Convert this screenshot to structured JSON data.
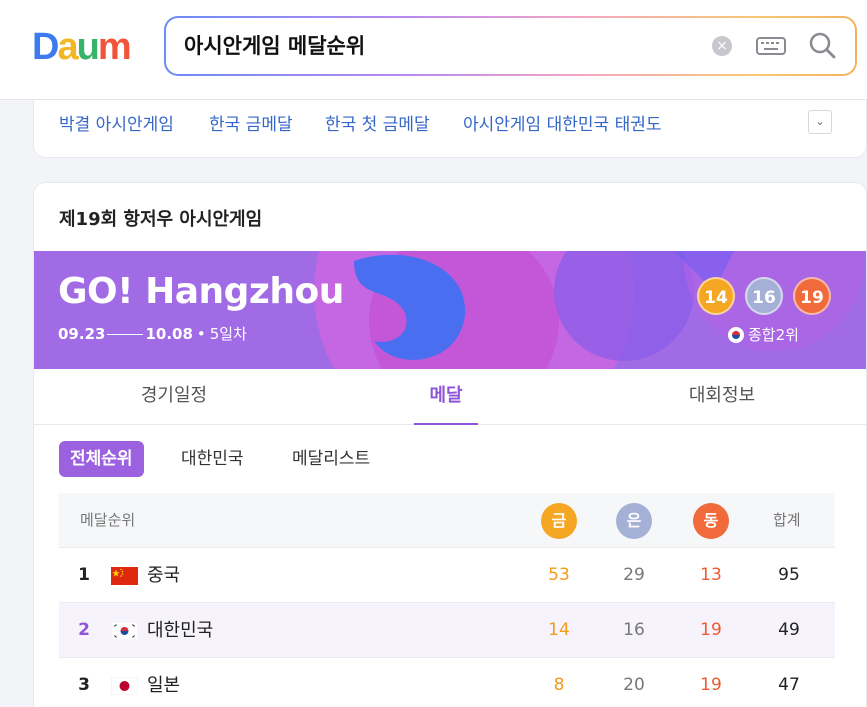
{
  "header": {
    "logo_text": "Daum",
    "search_query": "아시안게임 메달순위",
    "clear_icon": "close-circle-icon",
    "keyboard_icon": "keyboard-icon",
    "search_icon": "magnifier-icon"
  },
  "related_searches": {
    "items": [
      "박결 아시안게임",
      "한국 금메달",
      "한국 첫 금메달",
      "아시안게임 대한민국 태권도"
    ],
    "more_icon": "chevron-down-icon"
  },
  "card": {
    "title": "제19회 항저우 아시안게임",
    "banner": {
      "title": "GO! Hangzhou",
      "start_date": "09.23",
      "end_date": "10.08",
      "day_label": "5일차",
      "gold": "14",
      "silver": "16",
      "bronze": "19",
      "overall_rank": "종합2위"
    },
    "tabs": [
      "경기일정",
      "메달",
      "대회정보"
    ],
    "active_tab": "메달",
    "subtabs": [
      "전체순위",
      "대한민국",
      "메달리스트"
    ],
    "active_subtab": "전체순위"
  },
  "medal_table": {
    "header": {
      "label": "메달순위",
      "gold": "금",
      "silver": "은",
      "bronze": "동",
      "total": "합계"
    },
    "rows": [
      {
        "rank": "1",
        "country": "중국",
        "flag": "china-flag",
        "gold": "53",
        "silver": "29",
        "bronze": "13",
        "total": "95"
      },
      {
        "rank": "2",
        "country": "대한민국",
        "flag": "korea-flag",
        "gold": "14",
        "silver": "16",
        "bronze": "19",
        "total": "49"
      },
      {
        "rank": "3",
        "country": "일본",
        "flag": "japan-flag",
        "gold": "8",
        "silver": "20",
        "bronze": "19",
        "total": "47"
      }
    ]
  },
  "colors": {
    "accent_purple": "#9b61df",
    "gold": "#f5a623",
    "silver": "#a5b0d6",
    "bronze": "#f06a3b",
    "link_blue": "#3467c9"
  }
}
